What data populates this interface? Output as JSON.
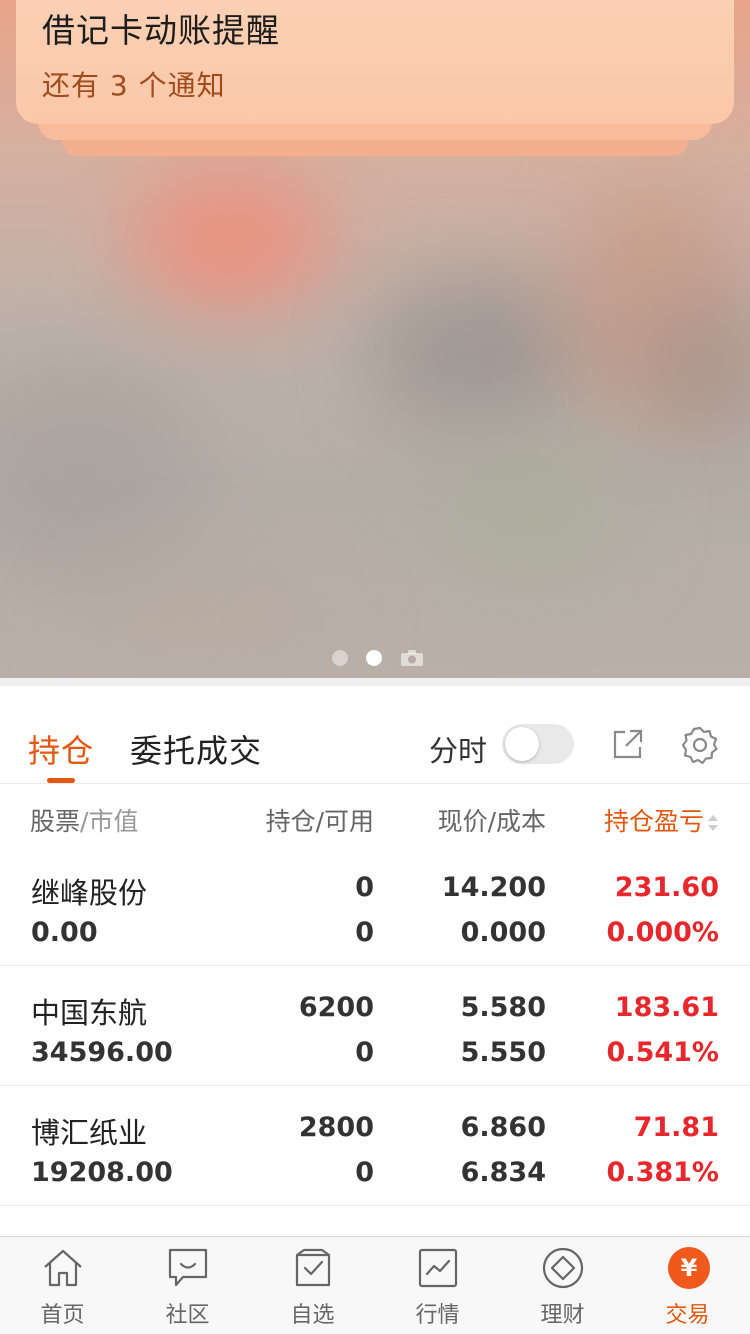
{
  "notification": {
    "title": "借记卡动账提醒",
    "subtitle": "还有 3 个通知"
  },
  "pager": {
    "total_dots": 2,
    "active_index": 1,
    "camera_icon": "camera-icon"
  },
  "tabs": {
    "holdings": "持仓",
    "orders": "委托成交",
    "intraday_label": "分时",
    "intraday_toggle": false
  },
  "columns": {
    "stock": "股票",
    "market_value": "/市值",
    "position": "持仓/可用",
    "price_cost": "现价/成本",
    "pnl": "持仓盈亏"
  },
  "holdings": [
    {
      "name": "继峰股份",
      "market_value": "0.00",
      "position": "0",
      "available": "0",
      "price": "14.200",
      "cost": "0.000",
      "pnl": "231.60",
      "pnl_pct": "0.000%"
    },
    {
      "name": "中国东航",
      "market_value": "34596.00",
      "position": "6200",
      "available": "0",
      "price": "5.580",
      "cost": "5.550",
      "pnl": "183.61",
      "pnl_pct": "0.541%"
    },
    {
      "name": "博汇纸业",
      "market_value": "19208.00",
      "position": "2800",
      "available": "0",
      "price": "6.860",
      "cost": "6.834",
      "pnl": "71.81",
      "pnl_pct": "0.381%"
    }
  ],
  "bottom_tabs": [
    {
      "label": "首页",
      "icon": "home-icon"
    },
    {
      "label": "社区",
      "icon": "chat-icon"
    },
    {
      "label": "自选",
      "icon": "watchlist-icon"
    },
    {
      "label": "行情",
      "icon": "chart-icon"
    },
    {
      "label": "理财",
      "icon": "diamond-icon"
    },
    {
      "label": "交易",
      "icon": "yuan-icon",
      "active": true
    }
  ],
  "colors": {
    "accent": "#e4570f",
    "up_red": "#e8272d"
  }
}
